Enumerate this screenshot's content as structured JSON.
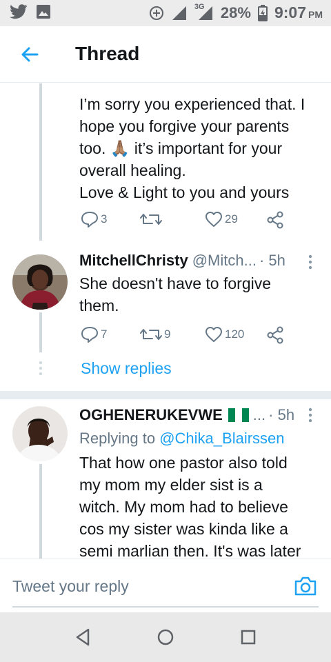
{
  "status_bar": {
    "network_label": "3G",
    "battery": "28%",
    "time": "9:07",
    "ampm": "PM"
  },
  "header": {
    "title": "Thread"
  },
  "tweets": [
    {
      "text_lines": [
        "I’m sorry you experienced that. I",
        "hope you forgive your parents",
        "too. 🙏🏽 it’s important for your",
        "overall healing.",
        "Love & Light to you and yours"
      ],
      "replies": "3",
      "retweets": "",
      "likes": "29"
    },
    {
      "name": "MitchellChristy",
      "handle": "@Mitch...",
      "time": "· 5h",
      "text_lines": [
        "She doesn't have to forgive",
        "them."
      ],
      "replies": "7",
      "retweets": "9",
      "likes": "120"
    },
    {
      "name": "OGHENERUKEVWE",
      "handle": "...",
      "time": "· 5h",
      "replying_prefix": "Replying to",
      "replying_to": "@Chika_Blairssen",
      "text_lines": [
        "That how one pastor also told",
        "my mom my elder sist is a",
        "witch. My mom had to believe",
        "cos my sister was kinda like a",
        "semi marlian then. It's was later"
      ]
    }
  ],
  "show_replies": "Show replies",
  "reply_bar": {
    "placeholder": "Tweet your reply"
  },
  "colors": {
    "accent": "#1da1f2",
    "muted": "#657786",
    "text": "#14171a"
  }
}
